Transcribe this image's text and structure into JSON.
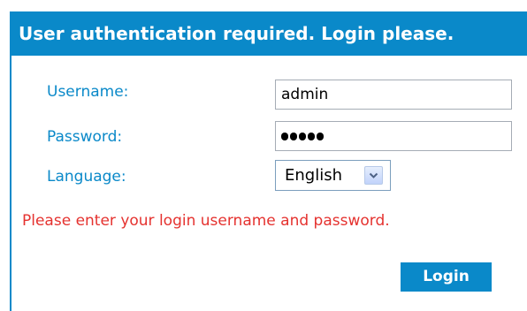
{
  "header": {
    "title": "User authentication required. Login please."
  },
  "form": {
    "username": {
      "label": "Username:",
      "value": "admin"
    },
    "password": {
      "label": "Password:",
      "masked_length": 5
    },
    "language": {
      "label": "Language:",
      "selected": "English",
      "arrow_icon": "chevron-down-icon"
    },
    "message": "Please enter your login username and password.",
    "login_label": "Login"
  },
  "colors": {
    "accent": "#0a89c9",
    "label_text": "#0a89c9",
    "message_text": "#e5322f",
    "button_text": "#ffffff",
    "select_arrow": "#4d6185"
  }
}
